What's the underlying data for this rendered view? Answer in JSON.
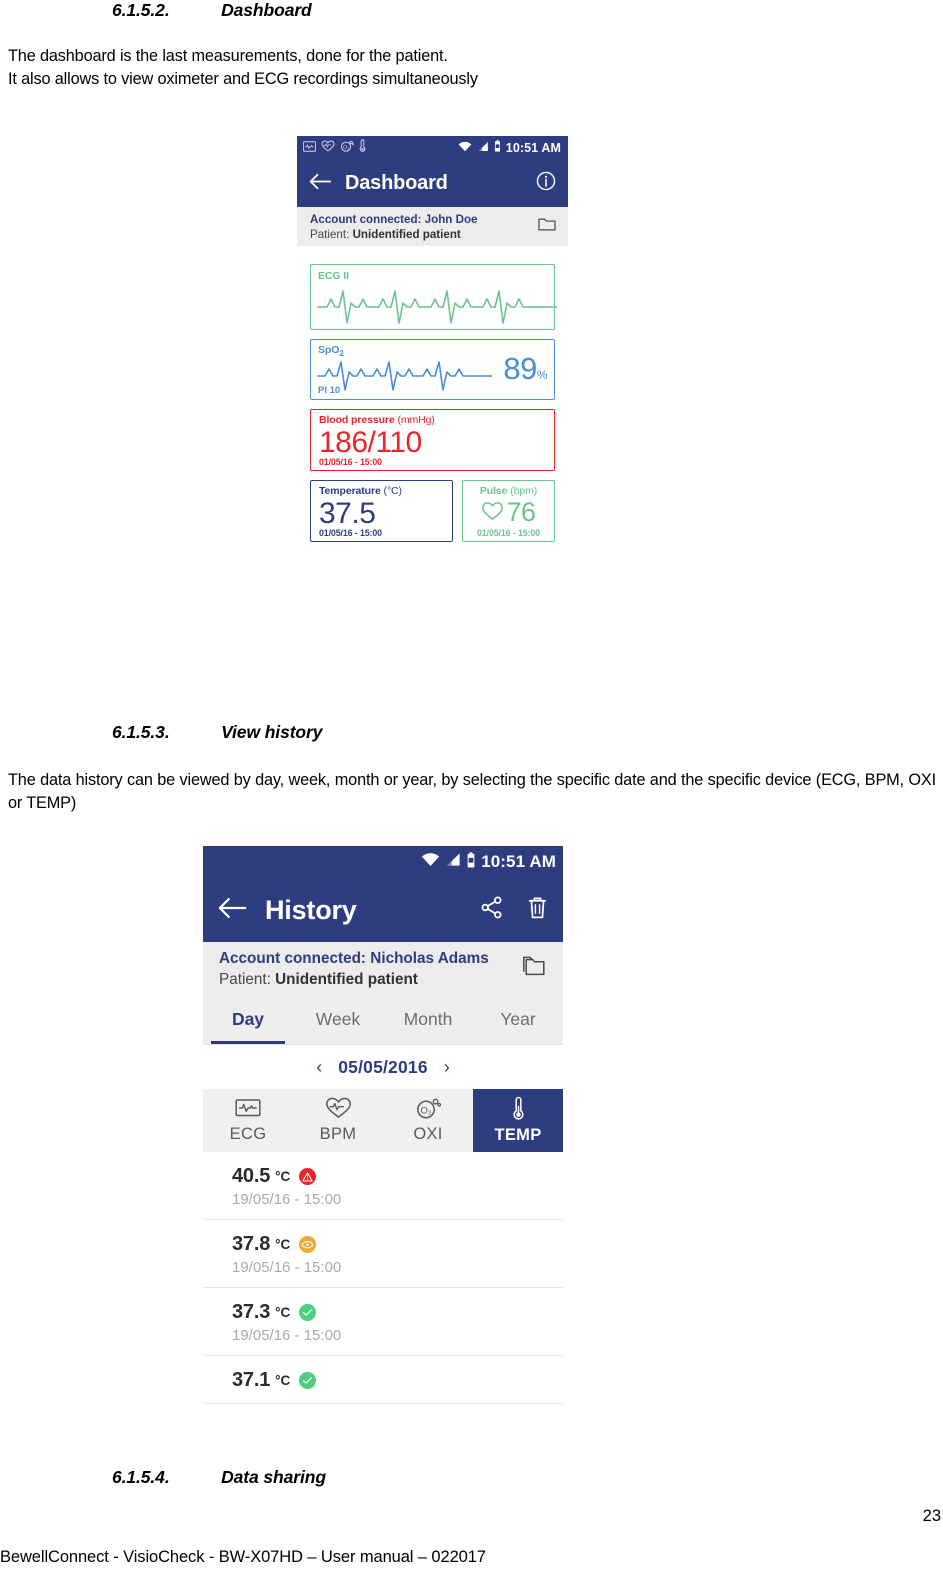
{
  "document": {
    "sections": [
      {
        "number": "6.1.5.2.",
        "title": "Dashboard"
      },
      {
        "number": "6.1.5.3.",
        "title": "View history"
      },
      {
        "number": "6.1.5.4.",
        "title": "Data sharing"
      }
    ],
    "paragraph_dashboard_line1": "The dashboard is the last measurements, done for the patient.",
    "paragraph_dashboard_line2": "It also allows to view oximeter and ECG recordings simultaneously",
    "paragraph_history": "The data history can be viewed by day, week, month or year, by selecting the specific date and the specific device (ECG, BPM, OXI or TEMP)",
    "footer": "BewellConnect - VisioCheck - BW-X07HD – User manual – 022017",
    "page_number": "23"
  },
  "dashboard_screen": {
    "statusbar": {
      "time": "10:51 AM",
      "device_icons": [
        "ecg-monitor-icon",
        "bpm-heart-icon",
        "oxi-icon",
        "thermometer-icon"
      ],
      "right_icons": [
        "wifi-icon",
        "signal-icon",
        "battery-icon"
      ]
    },
    "appbar": {
      "back_icon": "arrow-left-icon",
      "title": "Dashboard",
      "info_icon": "info-circle-icon"
    },
    "account": {
      "account_label": "Account connected:",
      "account_name": "John Doe",
      "patient_label": "Patient:",
      "patient_name": "Unidentified patient",
      "folder_icon": "folder-icon"
    },
    "cards": {
      "ecg": {
        "label": "ECG II",
        "color": "#6ac48d"
      },
      "spo2": {
        "label": "SpO",
        "label_sub": "2",
        "value": "89",
        "unit": "%",
        "pi": "PI 10",
        "color": "#4a8fd6"
      },
      "blood_pressure": {
        "label": "Blood pressure ",
        "unit": "(mmHg)",
        "value": "186/110",
        "timestamp": "01/05/16 - 15:00",
        "color": "#e8252a"
      },
      "temperature": {
        "label": "Temperature ",
        "unit": "(°C)",
        "value": "37.5",
        "timestamp": "01/05/16 - 15:00",
        "color": "#2e3c80"
      },
      "pulse": {
        "label": "Pulse ",
        "unit": "(bpm)",
        "value": "76",
        "timestamp": "01/05/16 - 15:00",
        "color": "#6ac48d",
        "icon": "heart-outline-icon"
      }
    }
  },
  "history_screen": {
    "statusbar": {
      "time": "10:51 AM",
      "right_icons": [
        "wifi-icon",
        "signal-icon",
        "battery-icon"
      ]
    },
    "appbar": {
      "back_icon": "arrow-left-icon",
      "title": "History",
      "share_icon": "share-icon",
      "delete_icon": "trash-icon"
    },
    "account": {
      "account_label": "Account connected:",
      "account_name": "Nicholas Adams",
      "patient_label": "Patient:",
      "patient_name": "Unidentified patient",
      "folder_icon": "folder-icon"
    },
    "period_tabs": [
      {
        "label": "Day",
        "active": true
      },
      {
        "label": "Week",
        "active": false
      },
      {
        "label": "Month",
        "active": false
      },
      {
        "label": "Year",
        "active": false
      }
    ],
    "date_nav": {
      "prev": "‹",
      "date": "05/05/2016",
      "next": "›"
    },
    "device_tabs": [
      {
        "label": "ECG",
        "icon": "ecg-monitor-icon",
        "active": false
      },
      {
        "label": "BPM",
        "icon": "bpm-heart-icon",
        "active": false
      },
      {
        "label": "OXI",
        "icon": "oxi-icon",
        "active": false
      },
      {
        "label": "TEMP",
        "icon": "thermometer-icon",
        "active": true
      }
    ],
    "measurements": [
      {
        "value": "40.5",
        "unit": "°C",
        "timestamp": "19/05/16 - 15:00",
        "status": "alert",
        "status_color": "#e8252a",
        "status_icon": "warning-icon"
      },
      {
        "value": "37.8",
        "unit": "°C",
        "timestamp": "19/05/16 - 15:00",
        "status": "warning",
        "status_color": "#f0a830",
        "status_icon": "eye-icon"
      },
      {
        "value": "37.3",
        "unit": "°C",
        "timestamp": "19/05/16 - 15:00",
        "status": "ok",
        "status_color": "#4cd07d",
        "status_icon": "check-icon"
      },
      {
        "value": "37.1",
        "unit": "°C",
        "timestamp": "",
        "status": "ok",
        "status_color": "#4cd07d",
        "status_icon": "check-icon"
      }
    ]
  }
}
